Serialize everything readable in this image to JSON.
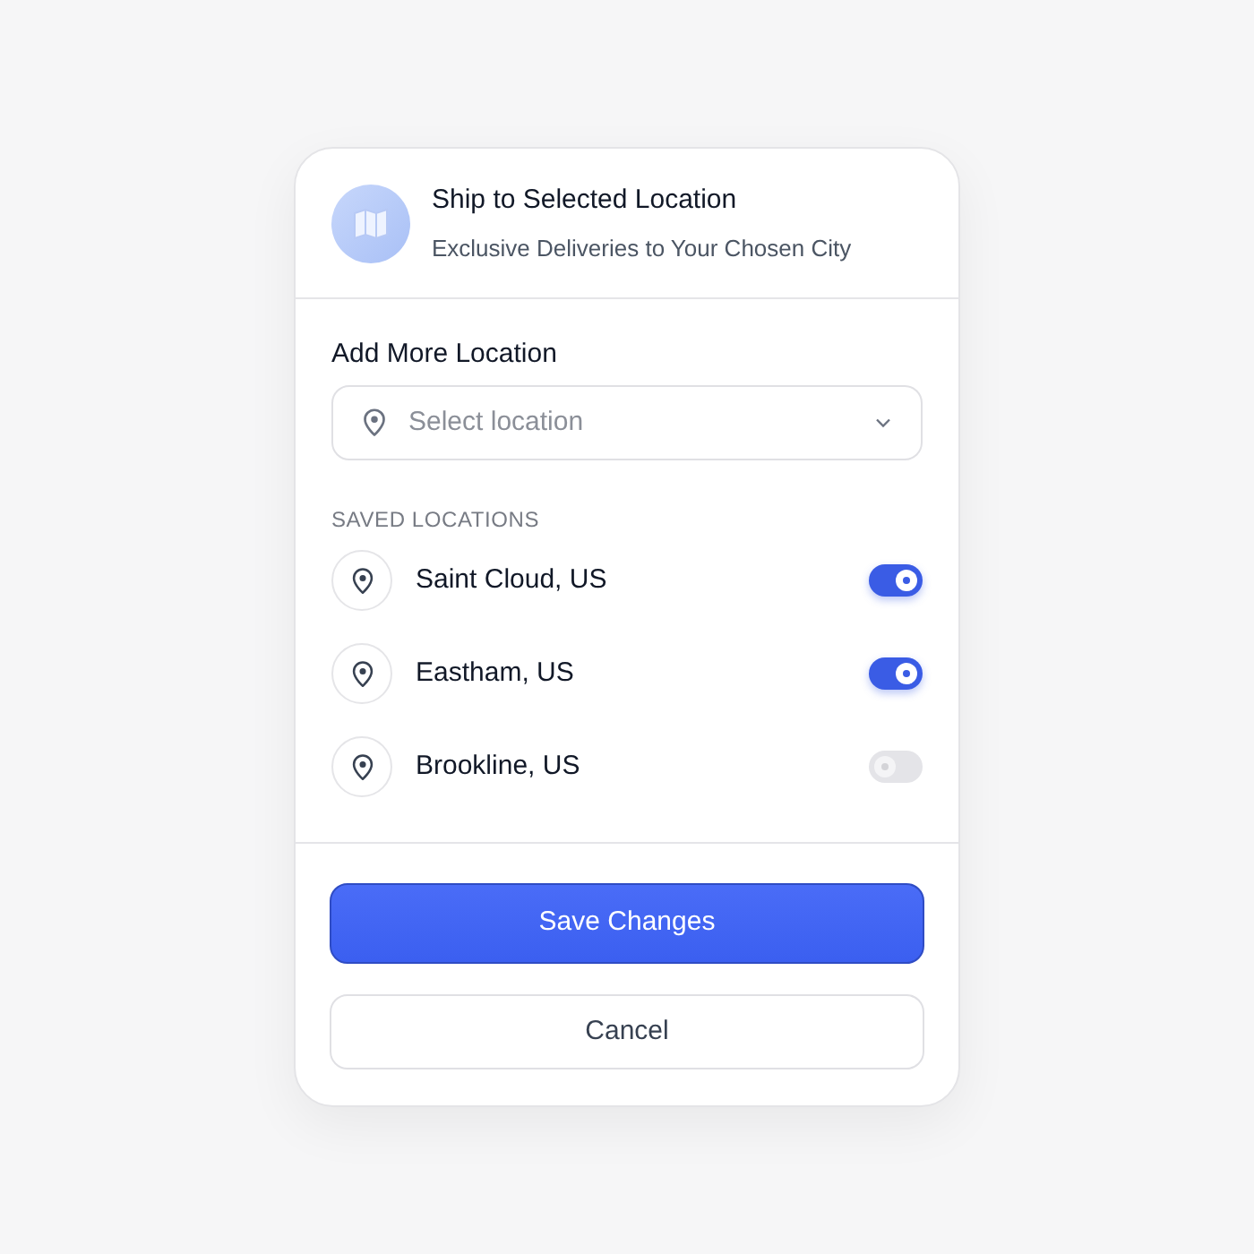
{
  "header": {
    "title": "Ship to Selected Location",
    "subtitle": "Exclusive Deliveries to Your Chosen City"
  },
  "add_location": {
    "label": "Add More Location",
    "placeholder": "Select location"
  },
  "saved_locations": {
    "heading": "SAVED LOCATIONS",
    "items": [
      {
        "name": "Saint Cloud, US",
        "on": true
      },
      {
        "name": "Eastham, US",
        "on": true
      },
      {
        "name": "Brookline, US",
        "on": false
      }
    ]
  },
  "buttons": [
    {
      "label": "Save Changes",
      "kind": "primary"
    },
    {
      "label": "Cancel",
      "kind": "secondary"
    }
  ]
}
